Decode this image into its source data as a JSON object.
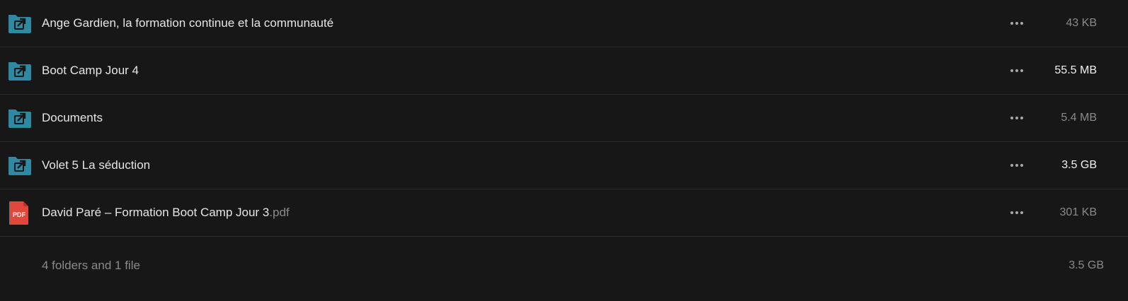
{
  "files": [
    {
      "name": "Ange Gardien, la formation continue et la communauté",
      "ext": "",
      "type": "shared-folder",
      "size": "43 KB",
      "size_strong": false
    },
    {
      "name": "Boot Camp Jour 4",
      "ext": "",
      "type": "shared-folder",
      "size": "55.5 MB",
      "size_strong": true
    },
    {
      "name": "Documents",
      "ext": "",
      "type": "shared-folder",
      "size": "5.4 MB",
      "size_strong": false
    },
    {
      "name": "Volet 5 La séduction",
      "ext": "",
      "type": "shared-folder",
      "size": "3.5 GB",
      "size_strong": true
    },
    {
      "name": "David Paré – Formation Boot Camp Jour 3",
      "ext": ".pdf",
      "type": "pdf",
      "size": "301 KB",
      "size_strong": false
    }
  ],
  "icons": {
    "folder_icon": "shared-folder-icon",
    "pdf_icon": "pdf-file-icon",
    "pdf_label": "PDF",
    "menu_icon": "more-horizontal-icon"
  },
  "colors": {
    "background": "#171717",
    "folder": "#2e8aa3",
    "pdf": "#e0483e"
  },
  "footer": {
    "summary": "4 folders and 1 file",
    "total": "3.5 GB"
  }
}
